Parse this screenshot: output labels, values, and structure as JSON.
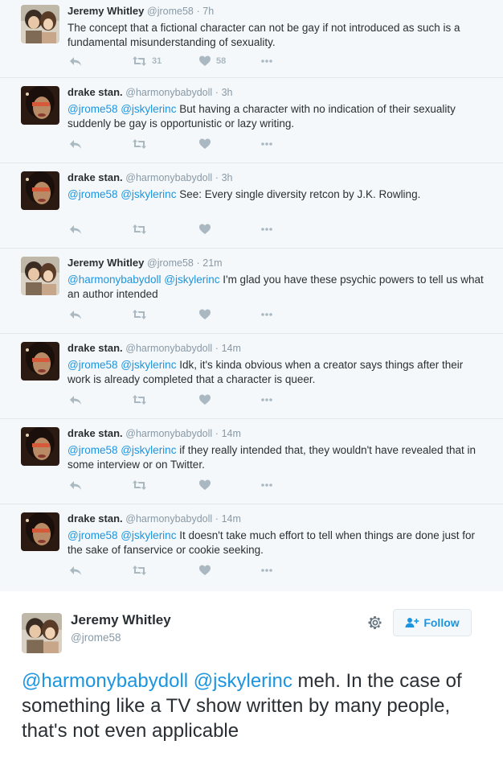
{
  "thread": [
    {
      "author": "jeremy",
      "name": "Jeremy Whitley",
      "handle": "@jrome58",
      "time": "7h",
      "mentions": "",
      "text": "The concept that a fictional character can not be gay if not introduced as such is a fundamental misunderstanding of sexuality.",
      "retweets": "31",
      "likes": "58"
    },
    {
      "author": "drake",
      "name": "drake stan.",
      "handle": "@harmonybabydoll",
      "time": "3h",
      "mentions": "@jrome58 @jskylerinc",
      "text": " But having a character with no indication of their sexuality suddenly be gay is opportunistic or lazy writing.",
      "retweets": "",
      "likes": ""
    },
    {
      "author": "drake",
      "name": "drake stan.",
      "handle": "@harmonybabydoll",
      "time": "3h",
      "mentions": "@jrome58 @jskylerinc",
      "text": " See: Every single diversity retcon by J.K. Rowling.",
      "retweets": "",
      "likes": ""
    },
    {
      "author": "jeremy",
      "name": "Jeremy Whitley",
      "handle": "@jrome58",
      "time": "21m",
      "mentions": "@harmonybabydoll @jskylerinc",
      "text": " I'm glad you have these psychic powers to tell us what an author intended",
      "retweets": "",
      "likes": ""
    },
    {
      "author": "drake",
      "name": "drake stan.",
      "handle": "@harmonybabydoll",
      "time": "14m",
      "mentions": "@jrome58 @jskylerinc",
      "text": " Idk, it's kinda obvious when a creator says things after their work is already completed that a character is queer.",
      "retweets": "",
      "likes": ""
    },
    {
      "author": "drake",
      "name": "drake stan.",
      "handle": "@harmonybabydoll",
      "time": "14m",
      "mentions": "@jrome58 @jskylerinc",
      "text": " if they really intended that, they wouldn't have revealed that in some interview or on Twitter.",
      "retweets": "",
      "likes": ""
    },
    {
      "author": "drake",
      "name": "drake stan.",
      "handle": "@harmonybabydoll",
      "time": "14m",
      "mentions": "@jrome58 @jskylerinc",
      "text": " It doesn't take much effort to tell when things are done just for the sake of fanservice or cookie seeking.",
      "retweets": "",
      "likes": ""
    }
  ],
  "main_tweet": {
    "name": "Jeremy Whitley",
    "handle": "@jrome58",
    "follow_label": "Follow",
    "mentions": "@harmonybabydoll @jskylerinc",
    "text": " meh. In the case of something like a TV show written by many people, that's not even applicable"
  },
  "colors": {
    "link": "#1b95e0",
    "action_icon": "#aab8c2",
    "muted_text": "#8899a6",
    "thread_bg": "#f5f8fa"
  },
  "icons": [
    "reply-icon",
    "retweet-icon",
    "like-icon",
    "more-icon",
    "gear-icon",
    "follow-person-icon"
  ]
}
